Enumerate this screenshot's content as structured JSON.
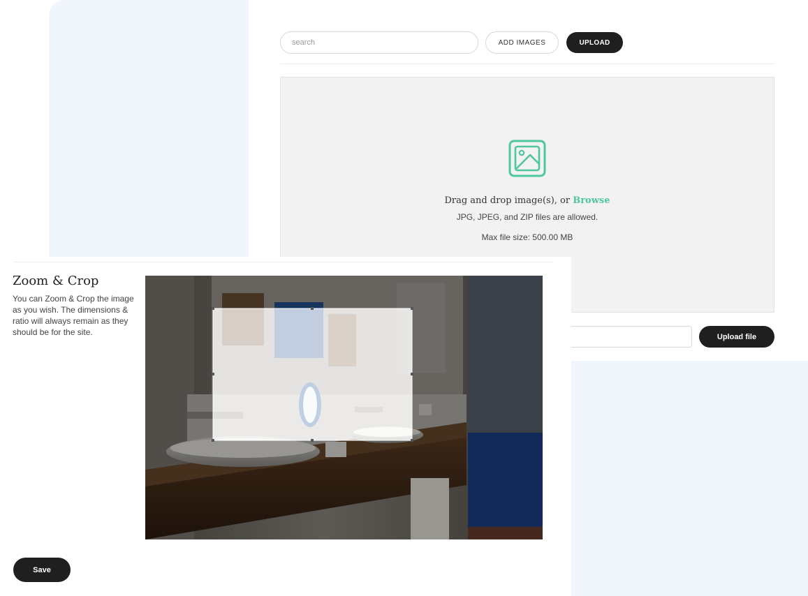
{
  "toolbar": {
    "search_placeholder": "search",
    "add_images_label": "ADD IMAGES",
    "upload_label": "UPLOAD"
  },
  "dropzone": {
    "drag_text": "Drag and drop image(s), or",
    "browse_label": "Browse",
    "allowed_text": "JPG, JPEG, and ZIP files are allowed.",
    "max_size_text": "Max file size: 500.00 MB",
    "upload_file_label": "Upload file"
  },
  "crop_modal": {
    "title": "Zoom & Crop",
    "description": "You can Zoom & Crop the image as you wish. The dimensions & ratio will always remain as they should be for the site.",
    "save_label": "Save"
  },
  "colors": {
    "accent": "#4fc6a0",
    "dark_button": "#1f1f1f",
    "backdrop": "#f1f6fd"
  },
  "icons": [
    "image-icon"
  ]
}
